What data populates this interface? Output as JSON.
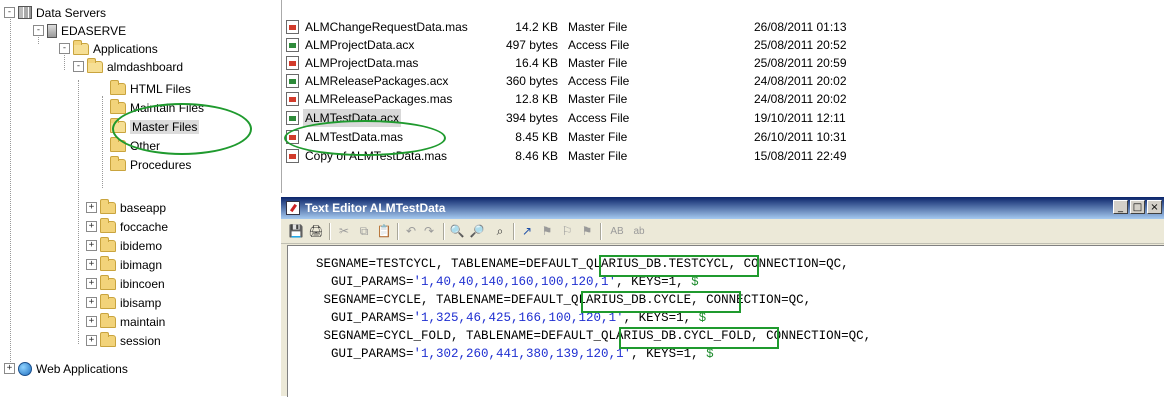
{
  "tree": {
    "root": "Data Servers",
    "server": "EDASERVE",
    "applications": "Applications",
    "almdashboard": "almdashboard",
    "html_files": "HTML Files",
    "maintain_files": "Maintain Files",
    "master_files": "Master Files",
    "other": "Other",
    "procedures": "Procedures",
    "apps": [
      "baseapp",
      "foccache",
      "ibidemo",
      "ibimagn",
      "ibincoen",
      "ibisamp",
      "maintain",
      "session"
    ],
    "web_applications": "Web Applications",
    "expander_plus": "+",
    "expander_minus": "-"
  },
  "files": [
    {
      "name": "ALMChangeRequestData.mas",
      "size": "14.2 KB",
      "type": "Master File",
      "date": "26/08/2011 01:13",
      "icon": "master-file-icon"
    },
    {
      "name": "ALMProjectData.acx",
      "size": "497 bytes",
      "type": "Access File",
      "date": "25/08/2011 20:52",
      "icon": "access-file-icon"
    },
    {
      "name": "ALMProjectData.mas",
      "size": "16.4 KB",
      "type": "Master File",
      "date": "25/08/2011 20:59",
      "icon": "master-file-icon"
    },
    {
      "name": "ALMReleasePackages.acx",
      "size": "360 bytes",
      "type": "Access File",
      "date": "24/08/2011 20:02",
      "icon": "access-file-icon"
    },
    {
      "name": "ALMReleasePackages.mas",
      "size": "12.8 KB",
      "type": "Master File",
      "date": "24/08/2011 20:02",
      "icon": "master-file-icon"
    },
    {
      "name": "ALMTestData.acx",
      "size": "394 bytes",
      "type": "Access File",
      "date": "19/10/2011 12:11",
      "icon": "access-file-icon"
    },
    {
      "name": "ALMTestData.mas",
      "size": "8.45 KB",
      "type": "Master File",
      "date": "26/10/2011 10:31",
      "icon": "master-file-icon"
    },
    {
      "name": "Copy of ALMTestData.mas",
      "size": "8.46 KB",
      "type": "Master File",
      "date": "15/08/2011 22:49",
      "icon": "master-file-icon"
    }
  ],
  "editor": {
    "title": "Text Editor ALMTestData",
    "window_buttons": {
      "minimize": "_",
      "maximize": "□",
      "close": "×"
    },
    "toolbar_text_buttons": {
      "ab_upper": "AB",
      "ab_lower": "ab"
    },
    "lines": [
      {
        "pre": "SEGNAME=TESTCYCL, TABLENAME=",
        "hl": "DEFAULT_QLARIUS_DB.",
        "post": "TESTCYCL, CONNECTION=QC,"
      },
      {
        "pre": "  GUI_PARAMS=",
        "blue": "'1,40,40,140,160,100,120,1'",
        "post": ", KEYS=1, ",
        "tail": "$"
      },
      {
        "pre": " SEGNAME=CYCLE, TABLENAME=",
        "hl": "DEFAULT_QLARIUS_DB.",
        "post": "CYCLE, CONNECTION=QC,"
      },
      {
        "pre": "  GUI_PARAMS=",
        "blue": "'1,325,46,425,166,100,120,1'",
        "post": ", KEYS=1, ",
        "tail": "$"
      },
      {
        "pre": " SEGNAME=CYCL_FOLD, TABLENAME=",
        "hl": "DEFAULT_QLARIUS_DB.",
        "post": "CYCL_FOLD, CONNECTION=QC,"
      },
      {
        "pre": "  GUI_PARAMS=",
        "blue": "'1,302,260,441,380,139,120,1'",
        "post": ", KEYS=1, ",
        "tail": "$"
      }
    ]
  },
  "colors": {
    "highlight": "#1f9a2e",
    "code_blue": "#1f2fd1",
    "titlebar": "#0a246a"
  }
}
